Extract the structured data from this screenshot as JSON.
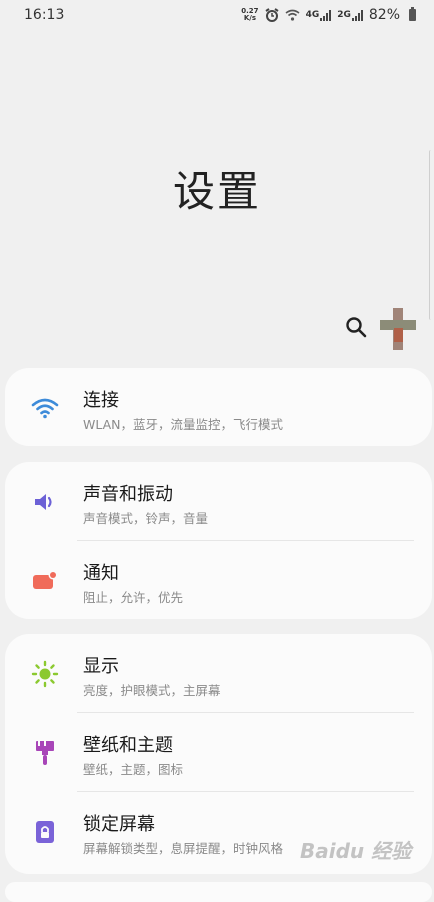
{
  "status_bar": {
    "time": "16:13",
    "net_speed_value": "0.27",
    "net_speed_unit": "K/s",
    "signal1_label": "4G",
    "signal2_label": "2G",
    "battery": "82%"
  },
  "page": {
    "title": "设置"
  },
  "items": [
    {
      "label": "连接",
      "sub": "WLAN，蓝牙，流量监控，飞行模式",
      "icon": "wifi-icon",
      "color": "#3d8bd9"
    },
    {
      "label": "声音和振动",
      "sub": "声音模式，铃声，音量",
      "icon": "speaker-icon",
      "color": "#6c61d6"
    },
    {
      "label": "通知",
      "sub": "阻止，允许，优先",
      "icon": "notification-icon",
      "color": "#f06b5a"
    },
    {
      "label": "显示",
      "sub": "亮度，护眼模式，主屏幕",
      "icon": "brightness-icon",
      "color": "#8bc92f"
    },
    {
      "label": "壁纸和主题",
      "sub": "壁纸，主题，图标",
      "icon": "paintbrush-icon",
      "color": "#a845b8"
    },
    {
      "label": "锁定屏幕",
      "sub": "屏幕解锁类型，息屏提醒，时钟风格",
      "icon": "lock-icon",
      "color": "#7a63d8"
    }
  ],
  "watermark": "Baidu 经验"
}
